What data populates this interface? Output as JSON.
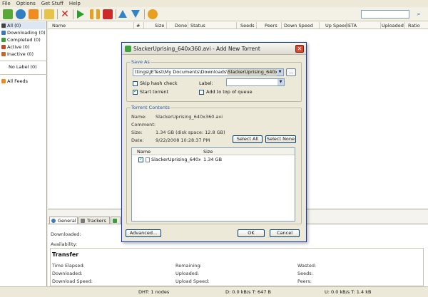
{
  "menu": [
    "File",
    "Options",
    "Get Stuff",
    "Help"
  ],
  "toolbar_icons": [
    "add-torrent-icon",
    "add-url-icon",
    "rss-icon",
    "create-torrent-icon",
    "remove-icon",
    "start-icon",
    "pause-icon",
    "stop-icon",
    "move-up-icon",
    "move-down-icon",
    "preferences-icon"
  ],
  "sidebar": {
    "items": [
      {
        "label": "All (0)",
        "color": "#444444"
      },
      {
        "label": "Downloading (0)",
        "color": "#3a78c2"
      },
      {
        "label": "Completed (0)",
        "color": "#3c9c3c"
      },
      {
        "label": "Active (0)",
        "color": "#c24a2a"
      },
      {
        "label": "Inactive (0)",
        "color": "#c2682a"
      }
    ],
    "nolabel": "No Label (0)",
    "feeds": "All Feeds"
  },
  "columns": [
    "Name",
    "#",
    "Size",
    "Done",
    "Status",
    "Seeds",
    "Peers",
    "Down Speed",
    "Up Speed",
    "ETA",
    "Uploaded",
    "Ratio"
  ],
  "bottom": {
    "tabs": [
      "General",
      "Trackers",
      ""
    ],
    "downloaded": "Downloaded:",
    "availability": "Availability:",
    "transfer_title": "Transfer",
    "transfer_left": [
      "Time Elapsed:",
      "Downloaded:",
      "Download Speed:"
    ],
    "transfer_mid": [
      "Remaining:",
      "Uploaded:",
      "Upload Speed:"
    ],
    "transfer_right": [
      "Wasted:",
      "Seeds:",
      "Peers:"
    ]
  },
  "statusbar": {
    "dht": "DHT: 1 nodes",
    "down": "D: 0.0 kB/s T: 647 B",
    "up": "U: 0.0 kB/s T: 1.4 kB"
  },
  "dialog": {
    "title": "SlackerUprising_640x360.avi - Add New Torrent",
    "save_as_label": "Save As",
    "path_prefix": "ttings\\JETest\\My Documents\\Downloads\\",
    "path_selected": "SlackerUprising_640x360.avi",
    "browse": "...",
    "skip_hash": "Skip hash check",
    "start_torrent": "Start torrent",
    "label_label": "Label:",
    "add_top": "Add to top of queue",
    "contents_label": "Torrent Contents",
    "name_label": "Name:",
    "name_value": "SlackerUprising_640x360.avi",
    "comment_label": "Comment:",
    "comment_value": "",
    "size_label": "Size:",
    "size_value": "1.34 GB (disk space: 12.8 GB)",
    "date_label": "Date:",
    "date_value": "9/22/2008 10:28:37 PM",
    "select_all": "Select All",
    "select_none": "Select None",
    "files_header_name": "Name",
    "files_header_size": "Size",
    "file_name": "SlackerUprising_640x...",
    "file_size": "1.34 GB",
    "advanced": "Advanced...",
    "ok": "OK",
    "cancel": "Cancel"
  }
}
